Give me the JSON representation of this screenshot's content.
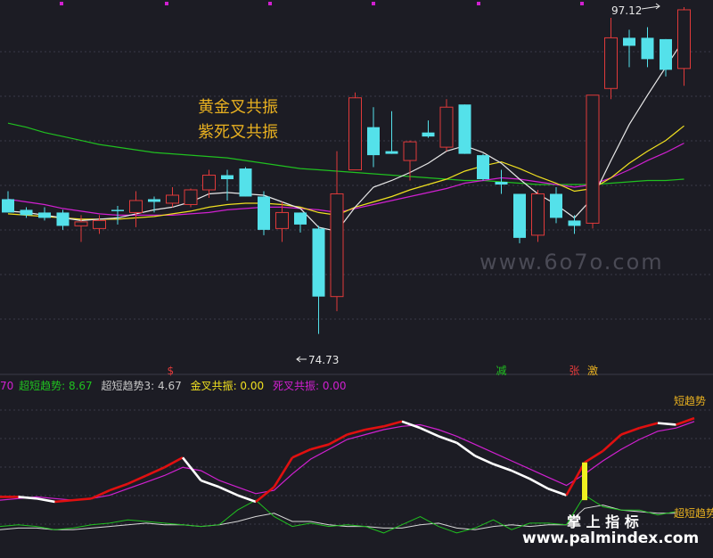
{
  "colors": {
    "background": "#1c1c24",
    "up": "#e03a3a",
    "down": "#54e1ea",
    "ma_white": "#e8e8e8",
    "ma_yellow": "#f0e020",
    "ma_magenta": "#d020d0",
    "ma_green": "#20c020",
    "annotation": "#e8b020",
    "grid": "#3a3a48"
  },
  "annotations": {
    "line1": "黄金叉共振",
    "line2": "紫死叉共振"
  },
  "price_labels": {
    "high": "97.12",
    "low": "74.73"
  },
  "signals": [
    {
      "text": "$",
      "index": 9,
      "color": "#e03a3a"
    },
    {
      "text": "减",
      "index": 27,
      "color": "#20c020"
    },
    {
      "text": "张",
      "index": 31,
      "color": "#e03a3a"
    },
    {
      "text": "激",
      "index": 32,
      "color": "#e8b020"
    }
  ],
  "indicator_bar": {
    "prefix": "70",
    "item1": "超短趋势: 8.67",
    "item2": "超短趋势3: 4.67",
    "item3": "金叉共振: 0.00",
    "item4": "死叉共振: 0.00"
  },
  "lower_labels": {
    "right_top": "短趋势",
    "right_bottom": "超短趋势"
  },
  "watermarks": {
    "center": "www.6o7o.com",
    "bottom_cn": "掌 上 指 标",
    "bottom_url": "www.palmindex.com"
  },
  "chart_data": {
    "type": "candlestick",
    "ylim": [
      72,
      99
    ],
    "candles": [
      {
        "o": 84.6,
        "h": 85.2,
        "l": 83.6,
        "c": 83.6
      },
      {
        "o": 83.8,
        "h": 84.0,
        "l": 83.2,
        "c": 83.4
      },
      {
        "o": 83.6,
        "h": 84.0,
        "l": 83.0,
        "c": 83.2
      },
      {
        "o": 83.6,
        "h": 83.8,
        "l": 82.3,
        "c": 82.6
      },
      {
        "o": 82.6,
        "h": 83.4,
        "l": 81.4,
        "c": 82.9
      },
      {
        "o": 82.4,
        "h": 83.4,
        "l": 82.0,
        "c": 83.0
      },
      {
        "o": 83.8,
        "h": 84.1,
        "l": 82.7,
        "c": 83.7
      },
      {
        "o": 83.6,
        "h": 85.2,
        "l": 82.5,
        "c": 84.5
      },
      {
        "o": 84.6,
        "h": 84.8,
        "l": 83.6,
        "c": 84.4
      },
      {
        "o": 84.3,
        "h": 85.5,
        "l": 84.0,
        "c": 84.9
      },
      {
        "o": 84.2,
        "h": 85.4,
        "l": 84.0,
        "c": 85.3
      },
      {
        "o": 85.3,
        "h": 86.8,
        "l": 84.7,
        "c": 86.4
      },
      {
        "o": 86.4,
        "h": 86.8,
        "l": 84.5,
        "c": 86.1
      },
      {
        "o": 86.9,
        "h": 87.0,
        "l": 84.8,
        "c": 84.8
      },
      {
        "o": 84.8,
        "h": 85.2,
        "l": 81.9,
        "c": 82.3
      },
      {
        "o": 82.4,
        "h": 84.4,
        "l": 81.4,
        "c": 83.6
      },
      {
        "o": 83.6,
        "h": 83.6,
        "l": 82.1,
        "c": 82.7
      },
      {
        "o": 82.4,
        "h": 82.6,
        "l": 74.5,
        "c": 77.3
      },
      {
        "o": 77.3,
        "h": 88.2,
        "l": 76.2,
        "c": 85.0
      },
      {
        "o": 86.8,
        "h": 92.6,
        "l": 86.8,
        "c": 92.2
      },
      {
        "o": 90.0,
        "h": 91.5,
        "l": 87.0,
        "c": 87.9
      },
      {
        "o": 88.2,
        "h": 91.2,
        "l": 88.0,
        "c": 88.0
      },
      {
        "o": 87.5,
        "h": 89.0,
        "l": 86.0,
        "c": 88.9
      },
      {
        "o": 89.6,
        "h": 90.5,
        "l": 89.2,
        "c": 89.3
      },
      {
        "o": 88.5,
        "h": 92.1,
        "l": 88.2,
        "c": 91.5
      },
      {
        "o": 91.7,
        "h": 91.7,
        "l": 88.0,
        "c": 88.0
      },
      {
        "o": 87.9,
        "h": 88.0,
        "l": 86.0,
        "c": 86.1
      },
      {
        "o": 85.9,
        "h": 86.8,
        "l": 85.0,
        "c": 85.7
      },
      {
        "o": 85.0,
        "h": 85.0,
        "l": 81.3,
        "c": 81.7
      },
      {
        "o": 81.9,
        "h": 85.3,
        "l": 81.4,
        "c": 85.0
      },
      {
        "o": 85.0,
        "h": 85.5,
        "l": 82.8,
        "c": 83.2
      },
      {
        "o": 83.0,
        "h": 83.4,
        "l": 82.0,
        "c": 82.6
      },
      {
        "o": 82.8,
        "h": 92.4,
        "l": 82.4,
        "c": 92.4
      },
      {
        "o": 92.9,
        "h": 98.2,
        "l": 92.1,
        "c": 96.7
      },
      {
        "o": 96.7,
        "h": 97.3,
        "l": 94.5,
        "c": 96.1
      },
      {
        "o": 96.7,
        "h": 97.5,
        "l": 94.5,
        "c": 95.1
      },
      {
        "o": 96.6,
        "h": 96.6,
        "l": 93.8,
        "c": 94.3
      },
      {
        "o": 94.4,
        "h": 99.0,
        "l": 93.1,
        "c": 98.8
      }
    ],
    "ma_white": [
      83.7,
      83.6,
      83.4,
      83.2,
      83.0,
      83.1,
      83.2,
      83.5,
      83.8,
      84.0,
      84.4,
      85.0,
      85.1,
      85.0,
      84.9,
      84.4,
      83.9,
      82.5,
      82.2,
      84.0,
      85.5,
      86.0,
      86.6,
      87.3,
      88.2,
      88.6,
      88.1,
      87.3,
      86.1,
      85.0,
      84.2,
      83.2,
      84.7,
      87.5,
      90.2,
      92.4,
      94.5,
      96.6
    ],
    "ma_yellow": [
      83.5,
      83.4,
      83.3,
      83.2,
      83.1,
      83.1,
      83.1,
      83.2,
      83.3,
      83.5,
      83.7,
      84.0,
      84.2,
      84.3,
      84.3,
      84.2,
      84.0,
      83.6,
      83.4,
      84.0,
      84.4,
      84.8,
      85.3,
      85.7,
      86.1,
      86.7,
      87.1,
      87.4,
      86.9,
      86.3,
      85.8,
      85.2,
      85.4,
      86.2,
      87.3,
      88.2,
      89.0,
      90.1
    ],
    "ma_magenta": [
      84.6,
      84.4,
      84.2,
      83.9,
      83.7,
      83.5,
      83.4,
      83.4,
      83.4,
      83.4,
      83.5,
      83.6,
      83.8,
      83.9,
      84.0,
      84.0,
      83.9,
      83.8,
      83.6,
      83.9,
      84.2,
      84.5,
      84.8,
      85.1,
      85.4,
      85.8,
      86.0,
      86.2,
      86.1,
      85.9,
      85.7,
      85.5,
      85.7,
      86.2,
      86.8,
      87.5,
      88.1,
      88.8
    ],
    "ma_green": [
      90.3,
      90.0,
      89.6,
      89.3,
      89.0,
      88.7,
      88.5,
      88.3,
      88.1,
      88.0,
      87.9,
      87.8,
      87.7,
      87.5,
      87.3,
      87.1,
      86.9,
      86.8,
      86.7,
      86.6,
      86.5,
      86.4,
      86.3,
      86.2,
      86.1,
      86.0,
      86.0,
      85.9,
      85.8,
      85.7,
      85.7,
      85.7,
      85.7,
      85.8,
      85.9,
      86.0,
      86.0,
      86.1
    ],
    "lower_indicator": {
      "ylim": [
        0,
        100
      ],
      "short_trend": [
        34,
        34,
        33,
        31,
        32,
        33,
        38,
        42,
        47,
        52,
        58,
        44,
        40,
        35,
        31,
        40,
        58,
        63,
        66,
        72,
        75,
        77,
        80,
        76,
        71,
        67,
        59,
        54,
        50,
        45,
        39,
        35,
        55,
        62,
        72,
        76,
        79,
        78,
        82
      ],
      "short_trend_ma": [
        32,
        33,
        34,
        33,
        32,
        33,
        35,
        39,
        43,
        47,
        52,
        50,
        44,
        40,
        36,
        38,
        48,
        57,
        63,
        69,
        72,
        75,
        77,
        78,
        75,
        71,
        66,
        61,
        56,
        51,
        46,
        41,
        48,
        56,
        63,
        69,
        74,
        76,
        80
      ],
      "bar": {
        "index": 32,
        "value": 55
      },
      "ultra_short": [
        16,
        17,
        16,
        14,
        15,
        17,
        18,
        20,
        19,
        18,
        17,
        16,
        17,
        26,
        32,
        22,
        16,
        18,
        16,
        17,
        16,
        12,
        17,
        22,
        16,
        12,
        15,
        20,
        14,
        18,
        18,
        17,
        35,
        28,
        26,
        26,
        23,
        25
      ],
      "ultra_short_3": [
        14,
        15,
        15,
        14,
        14,
        15,
        16,
        17,
        18,
        17,
        17,
        16,
        17,
        19,
        22,
        24,
        19,
        19,
        17,
        16,
        16,
        15,
        15,
        17,
        18,
        15,
        14,
        16,
        17,
        16,
        17,
        17,
        27,
        29,
        26,
        25,
        24,
        24
      ]
    }
  }
}
